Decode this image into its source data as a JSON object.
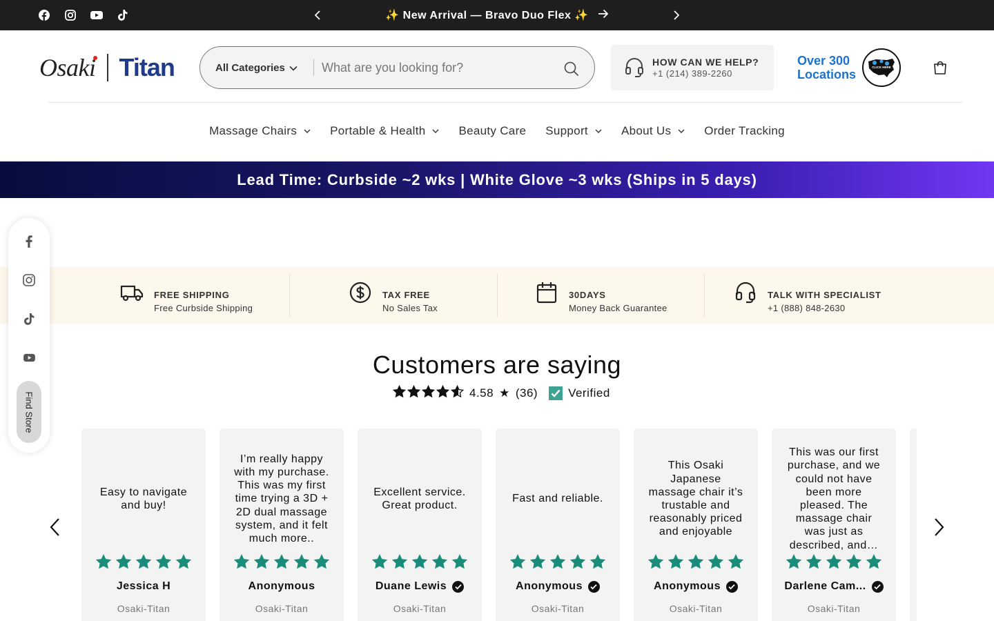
{
  "announcement": {
    "text": "✨ New Arrival — Bravo Duo Flex ✨",
    "social": [
      "facebook-icon",
      "instagram-icon",
      "youtube-icon",
      "tiktok-icon"
    ]
  },
  "header": {
    "logo_primary": "Osaki",
    "logo_secondary": "Titan",
    "search": {
      "category_label": "All Categories",
      "placeholder": "What are you looking for?"
    },
    "help": {
      "title": "HOW CAN WE HELP?",
      "phone": "+1 (214) 389-2260"
    },
    "locations": {
      "line1": "Over 300",
      "line2": "Locations",
      "badge_text": "CLICK HERE"
    }
  },
  "nav": {
    "items": [
      {
        "label": "Massage Chairs",
        "dropdown": true
      },
      {
        "label": "Portable & Health",
        "dropdown": true
      },
      {
        "label": "Beauty Care",
        "dropdown": false
      },
      {
        "label": "Support",
        "dropdown": true
      },
      {
        "label": "About Us",
        "dropdown": true
      },
      {
        "label": "Order Tracking",
        "dropdown": false
      }
    ]
  },
  "lead_banner": "Lead Time: Curbside ~2 wks | White Glove ~3 wks (Ships in 5 days)",
  "floating_social": {
    "find_store": "Find Store"
  },
  "features": [
    {
      "title": "FREE SHIPPING",
      "subtitle": "Free Curbside Shipping",
      "icon": "truck-icon"
    },
    {
      "title": "TAX FREE",
      "subtitle": "No Sales Tax",
      "icon": "dollar-icon"
    },
    {
      "title": "30DAYS",
      "subtitle": "Money Back Guarantee",
      "icon": "calendar-icon"
    },
    {
      "title": "TALK WITH SPECIALIST",
      "subtitle": "+1 (888) 848-2630",
      "icon": "headset-icon"
    }
  ],
  "reviews": {
    "title": "Customers are saying",
    "rating": "4.58",
    "rating_star": "★",
    "count": "(36)",
    "verified_label": "Verified",
    "star_color": "#1a8c7a",
    "items": [
      {
        "text": "Easy to navigate and buy!",
        "name": "Jessica H",
        "verified": false,
        "store": "Osaki-Titan",
        "stars": 5
      },
      {
        "text": "I’m really happy with my purchase. This was my first time trying a 3D + 2D dual massage system, and it felt much more..",
        "name": "Anonymous",
        "verified": false,
        "store": "Osaki-Titan",
        "stars": 5
      },
      {
        "text": "Excellent service. Great product.",
        "name": "Duane Lewis",
        "verified": true,
        "store": "Osaki-Titan",
        "stars": 5
      },
      {
        "text": "Fast and reliable.",
        "name": "Anonymous",
        "verified": true,
        "store": "Osaki-Titan",
        "stars": 5
      },
      {
        "text": "This Osaki Japanese massage chair it’s trustable and reasonably priced and enjoyable",
        "name": "Anonymous",
        "verified": true,
        "store": "Osaki-Titan",
        "stars": 5
      },
      {
        "text": "This was our first purchase, and we could not have been more pleased. The massage chair was just as described, and…",
        "name": "Darlene Cam...",
        "verified": true,
        "store": "Osaki-Titan",
        "stars": 5
      },
      {
        "text": "",
        "name": "",
        "verified": false,
        "store": "",
        "stars": 0
      }
    ]
  }
}
